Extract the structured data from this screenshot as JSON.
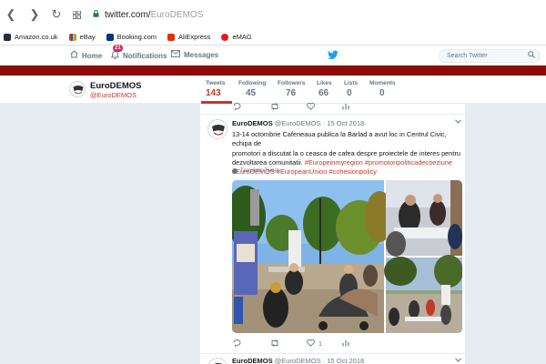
{
  "browser": {
    "url_host": "twitter.com/",
    "url_path": "EuroDEMOS",
    "bookmarks": [
      {
        "label": "Amazon.co.uk",
        "color": "#232f3e"
      },
      {
        "label": "eBay",
        "color": "#e53238"
      },
      {
        "label": "Booking.com",
        "color": "#003580"
      },
      {
        "label": "AliExpress",
        "color": "#e62e04"
      },
      {
        "label": "eMAG",
        "color": "#e01a22"
      }
    ]
  },
  "twitter_nav": {
    "home": "Home",
    "notifications": "Notifications",
    "notifications_count": "21",
    "messages": "Messages",
    "search_placeholder": "Search Twitter"
  },
  "profile": {
    "name": "EuroDEMOS",
    "handle": "@EuroDEMOS",
    "stats": [
      {
        "label": "Tweets",
        "value": "143"
      },
      {
        "label": "Following",
        "value": "45"
      },
      {
        "label": "Followers",
        "value": "76"
      },
      {
        "label": "Likes",
        "value": "66"
      },
      {
        "label": "Lists",
        "value": "0"
      },
      {
        "label": "Moments",
        "value": "0"
      }
    ]
  },
  "tweet": {
    "name": "EuroDEMOS",
    "meta": "@EuroDEMOS · 15 Oct 2018",
    "text_line1": "13-14 octombrie Cafeneaua publica la Barlad a avut loc in Centrul Civic, echipa de",
    "text_line2": "promotori a discutat la o ceasca de cafea despre proiectele de interes pentru",
    "text_line3_plain": "dezvoltarea comunitatii.",
    "text_line3_tags": "#Europeinmyregion #promotoripoliticadecoeziune",
    "text_line4_tags": "#EuroDEMOS #EuropeanUnion #cohesionpolicy",
    "translate": "Translate Tweet",
    "likes_count": "1"
  },
  "next_tweet": {
    "name": "EuroDEMOS",
    "meta": "@EuroDEMOS · 15 Oct 2018"
  },
  "colors": {
    "accent": "#c0392b",
    "band": "#8b0a0a",
    "twitter_blue": "#1da1f2"
  }
}
